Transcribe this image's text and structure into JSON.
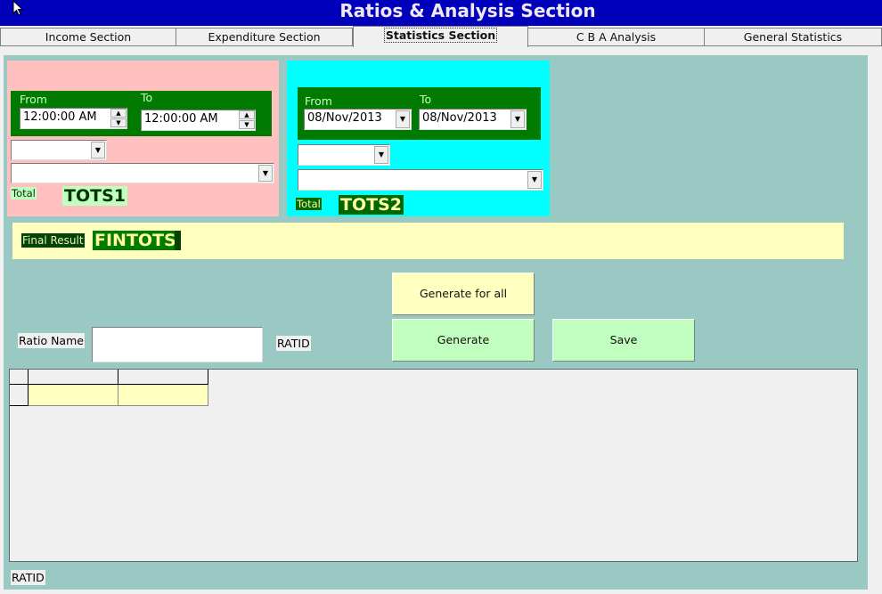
{
  "window": {
    "title": "Ratios & Analysis Section"
  },
  "tabs": [
    {
      "label": "Income Section",
      "active": false
    },
    {
      "label": "Expenditure Section",
      "active": false
    },
    {
      "label": "Statistics Section",
      "active": true
    },
    {
      "label": "C  B A Analysis",
      "active": false
    },
    {
      "label": "General Statistics",
      "active": false
    }
  ],
  "panel1": {
    "from_label": "From",
    "to_label": "To",
    "from_value": "12:00:00 AM",
    "to_value": "12:00:00 AM",
    "combo_small_value": "",
    "combo_wide_value": "",
    "total_label": "Total",
    "total_value": "TOTS1"
  },
  "panel2": {
    "from_label": "From",
    "to_label": "To",
    "from_value": "08/Nov/2013",
    "to_value": "08/Nov/2013",
    "combo_small_value": "",
    "combo_wide_value": "",
    "total_label": "Total",
    "total_value": "TOTS2"
  },
  "final": {
    "label": "Final Result",
    "value": "FINTOTS"
  },
  "buttons": {
    "generate_all": "Generate for all",
    "generate": "Generate",
    "save": "Save"
  },
  "ratio": {
    "label": "Ratio Name",
    "value": "",
    "id_label": "RATID"
  },
  "grid": {
    "columns": [
      "",
      ""
    ],
    "rows": [
      [
        "",
        ""
      ]
    ]
  },
  "footer": {
    "id_label": "RATID"
  },
  "colors": {
    "titlebar": "#0000bb",
    "panel": "#99c9c2",
    "pink": "#ffc0c0",
    "cyan": "#00ffff",
    "green": "#007a00",
    "yellow": "#ffffc0",
    "lightgreen": "#c0ffc0"
  }
}
